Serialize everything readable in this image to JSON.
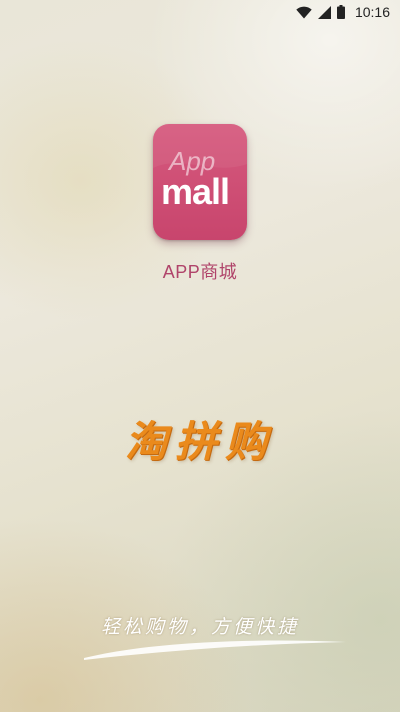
{
  "status_bar": {
    "time": "10:16",
    "icons": [
      "wifi-icon",
      "signal-icon",
      "battery-icon"
    ]
  },
  "logo": {
    "line1": "App",
    "line2": "mall",
    "color": "#c8456d"
  },
  "app_name": "APP商城",
  "slogan": "淘拼购",
  "tagline": "轻松购物，方便快捷",
  "colors": {
    "accent": "#c8456d",
    "slogan": "#ea8a1c"
  }
}
